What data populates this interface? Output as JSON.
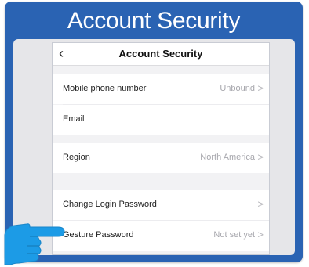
{
  "banner": {
    "title": "Account Security"
  },
  "nav": {
    "back_icon": "chevron-left-icon",
    "title": "Account Security"
  },
  "rows": [
    {
      "label": "Mobile phone number",
      "value": "Unbound",
      "chevron": ">"
    },
    {
      "label": "Email",
      "value": "",
      "chevron": ""
    },
    {
      "label": "Region",
      "value": "North America",
      "chevron": ">"
    },
    {
      "label": "Change Login Password",
      "value": "",
      "chevron": ">"
    },
    {
      "label": "Gesture Password",
      "value": "Not set yet",
      "chevron": ">"
    }
  ],
  "pointer": {
    "icon": "pointing-hand-icon",
    "color": "#1c9be6"
  },
  "colors": {
    "frame": "#2a63b3",
    "panel": "#e6e6e9",
    "row": "#ffffff",
    "group_bg": "#f2f2f4"
  }
}
